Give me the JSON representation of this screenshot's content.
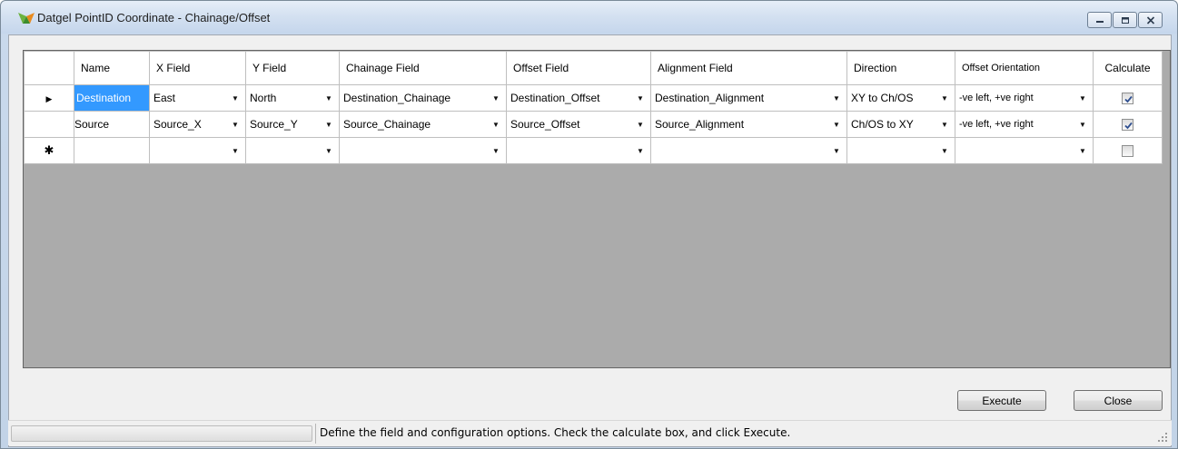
{
  "window": {
    "title": "Datgel PointID Coordinate - Chainage/Offset",
    "icon": "datgel-logo-icon",
    "controls": [
      "minimize-icon",
      "restore-icon",
      "close-icon"
    ]
  },
  "grid": {
    "columns": [
      "Name",
      "X Field",
      "Y Field",
      "Chainage Field",
      "Offset Field",
      "Alignment Field",
      "Direction",
      "Offset Orientation",
      "Calculate"
    ],
    "rows": [
      {
        "indicator": "▶",
        "name": "Destination",
        "x_field": "East",
        "y_field": "North",
        "chainage_field": "Destination_Chainage",
        "offset_field": "Destination_Offset",
        "alignment_field": "Destination_Alignment",
        "direction": "XY to Ch/OS",
        "offset_orientation": "-ve left, +ve right",
        "calculate": true
      },
      {
        "indicator": "",
        "name": "Source",
        "x_field": "Source_X",
        "y_field": "Source_Y",
        "chainage_field": "Source_Chainage",
        "offset_field": "Source_Offset",
        "alignment_field": "Source_Alignment",
        "direction": "Ch/OS to XY",
        "offset_orientation": "-ve left, +ve right",
        "calculate": true
      },
      {
        "indicator": "✱",
        "name": "",
        "x_field": "",
        "y_field": "",
        "chainage_field": "",
        "offset_field": "",
        "alignment_field": "",
        "direction": "",
        "offset_orientation": "",
        "calculate": false
      }
    ]
  },
  "buttons": {
    "execute": "Execute",
    "close": "Close"
  },
  "status": {
    "message": "Define the field and configuration options.  Check the calculate box, and click Execute."
  },
  "colors": {
    "selection": "#3399ff",
    "grid_background": "#ababab",
    "window_frame": "#c5d6ec"
  }
}
